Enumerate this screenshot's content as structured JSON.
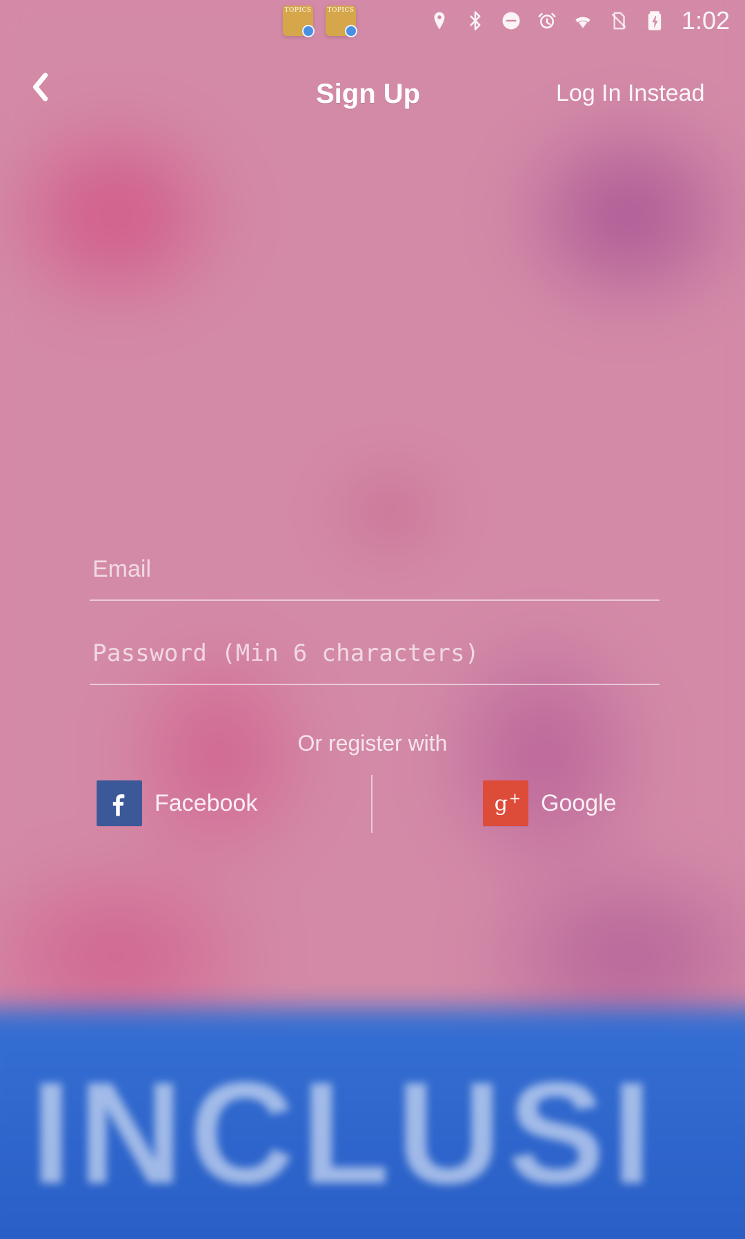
{
  "status_bar": {
    "time": "1:02",
    "app_shortcuts": [
      {
        "label": "TOPICS"
      },
      {
        "label": "TOPICS"
      }
    ],
    "icons": [
      "location-icon",
      "bluetooth-icon",
      "do-not-disturb-icon",
      "alarm-icon",
      "wifi-icon",
      "no-sim-icon",
      "battery-charging-icon"
    ]
  },
  "header": {
    "title": "Sign Up",
    "login_instead": "Log In Instead",
    "back_icon": "chevron-left-icon"
  },
  "form": {
    "email_placeholder": "Email",
    "password_placeholder": "Password (Min 6 characters)",
    "or_register_with": "Or register with"
  },
  "social": {
    "facebook_label": "Facebook",
    "google_label": "Google",
    "facebook_icon": "facebook-icon",
    "google_icon": "google-plus-icon",
    "facebook_color": "#3b5998",
    "google_color": "#dd4b39"
  },
  "background": {
    "image": "background-image",
    "text_watermark": "INCLUSI"
  }
}
